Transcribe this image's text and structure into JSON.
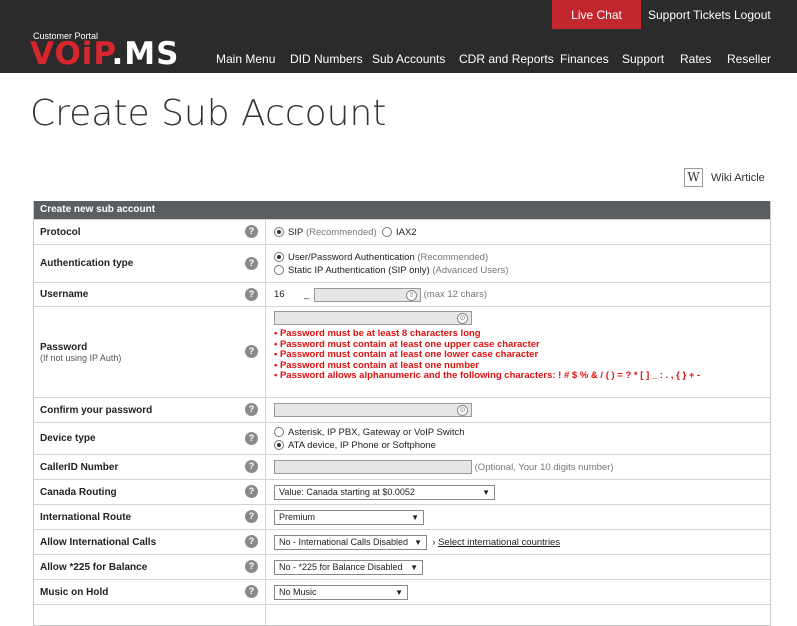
{
  "header": {
    "live_chat": "Live Chat",
    "support_tickets": "Support Tickets",
    "logout": "Logout",
    "logo_sub": "Customer Portal",
    "logo_a": "VOiP",
    "logo_b": ".MS",
    "nav": [
      "Main Menu",
      "DID Numbers",
      "Sub Accounts",
      "CDR and Reports",
      "Finances",
      "Support",
      "Rates",
      "Reseller"
    ]
  },
  "page": {
    "title": "Create Sub Account",
    "wiki_label": "Wiki Article"
  },
  "form": {
    "heading": "Create new sub account",
    "protocol": {
      "label": "Protocol",
      "opt1": "SIP",
      "opt1_note": "(Recommended)",
      "opt2": "IAX2"
    },
    "auth": {
      "label": "Authentication type",
      "opt1": "User/Password Authentication",
      "opt1_note": "(Recommended)",
      "opt2": "Static IP Authentication (SIP only)",
      "opt2_note": "(Advanced Users)"
    },
    "username": {
      "label": "Username",
      "prefix": "16",
      "sep": "_",
      "hint": "(max 12 chars)"
    },
    "password": {
      "label": "Password",
      "sublabel": "(If not using IP Auth)",
      "errors": [
        "• Password must be at least 8 characters long",
        "• Password must contain at least one upper case character",
        "• Password must contain at least one lower case character",
        "• Password must contain at least one number",
        "• Password allows alphanumeric and the following characters: ! # $ % & / ( ) = ? * [ ] _ : . , { } + -"
      ]
    },
    "confirm": {
      "label": "Confirm your password"
    },
    "device": {
      "label": "Device type",
      "opt1": "Asterisk, IP PBX, Gateway or VoIP Switch",
      "opt2": "ATA device, IP Phone or Softphone"
    },
    "callerid": {
      "label": "CallerID Number",
      "hint": "(Optional, Your 10 digits number)"
    },
    "canada": {
      "label": "Canada Routing",
      "value": "Value: Canada starting at $0.0052"
    },
    "intl_route": {
      "label": "International Route",
      "value": "Premium"
    },
    "intl_calls": {
      "label": "Allow International Calls",
      "value": "No - International Calls Disabled",
      "link": "Select international countries"
    },
    "balance": {
      "label": "Allow *225 for Balance",
      "value": "No - *225 for Balance Disabled"
    },
    "moh": {
      "label": "Music on Hold",
      "value": "No Music"
    }
  }
}
